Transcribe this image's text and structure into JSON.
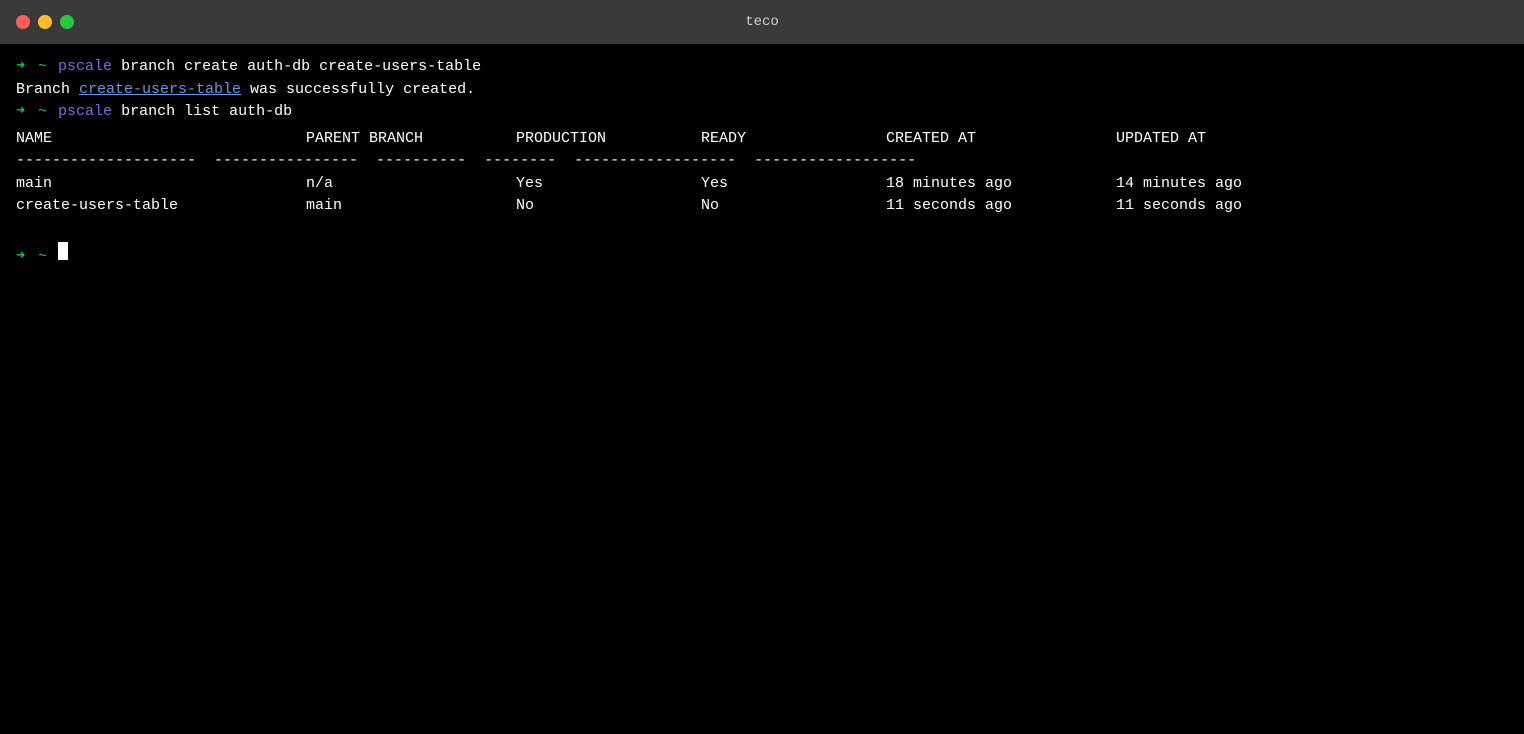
{
  "titlebar": {
    "title": "teco",
    "close_label": "close",
    "minimize_label": "minimize",
    "maximize_label": "maximize"
  },
  "terminal": {
    "line1": {
      "prompt_arrow": "➜",
      "prompt_tilde": " ~",
      "prompt_pscale": " pscale",
      "command": " branch create auth-db create-users-table"
    },
    "line2": {
      "prefix": "Branch ",
      "branch_name": "create-users-table",
      "suffix": " was successfully created."
    },
    "line3": {
      "prompt_arrow": "➜",
      "prompt_tilde": " ~",
      "prompt_pscale": " pscale",
      "command": " branch list auth-db"
    },
    "table": {
      "headers": {
        "name": "NAME",
        "parent_branch": "PARENT BRANCH",
        "production": "PRODUCTION",
        "ready": "READY",
        "created_at": "CREATED AT",
        "updated_at": "UPDATED AT"
      },
      "divider": "--------------------  ----------------  ----------  --------  ------------------  ------------------",
      "rows": [
        {
          "name": "main",
          "parent_branch": "n/a",
          "production": "Yes",
          "ready": "Yes",
          "created_at": "18 minutes ago",
          "updated_at": "14 minutes ago"
        },
        {
          "name": "create-users-table",
          "parent_branch": "main",
          "production": "No",
          "ready": "No",
          "created_at": "11 seconds ago",
          "updated_at": "11 seconds ago"
        }
      ]
    },
    "prompt_line": {
      "prompt_arrow": "➜",
      "prompt_tilde": " ~"
    }
  }
}
